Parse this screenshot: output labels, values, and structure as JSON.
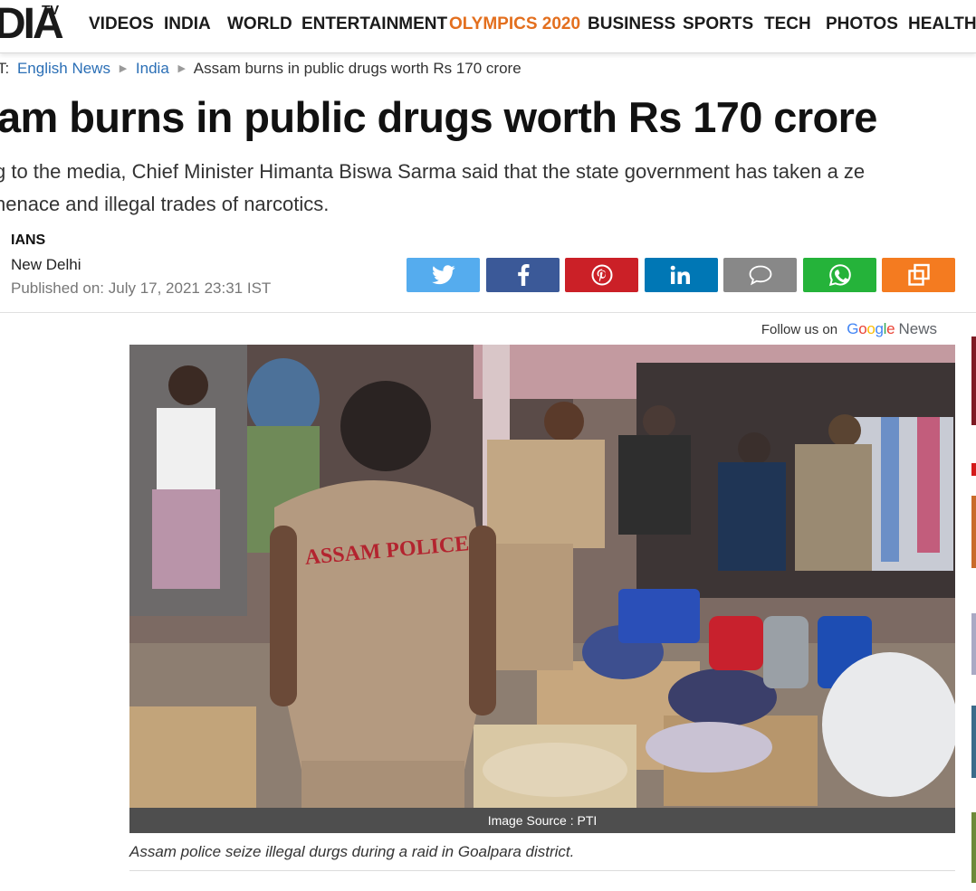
{
  "site": {
    "logo_text": "DIA",
    "logo_sup": "TV"
  },
  "nav": [
    {
      "label": "VIDEOS"
    },
    {
      "label": "INDIA"
    },
    {
      "label": "WORLD"
    },
    {
      "label": "ENTERTAINMENT"
    },
    {
      "label": "OLYMPICS 2020"
    },
    {
      "label": "BUSINESS"
    },
    {
      "label": "SPORTS"
    },
    {
      "label": "TECH"
    },
    {
      "label": "PHOTOS"
    },
    {
      "label": "HEALTH"
    }
  ],
  "colors": {
    "nav_highlight": "#e36f1e",
    "link_blue": "#2b6fb6",
    "twitter": "#55acee",
    "facebook": "#3b5998",
    "pinterest": "#cb2027",
    "linkedin": "#0077b5",
    "comment": "#888888",
    "whatsapp": "#25b33a",
    "copy": "#f47b20"
  },
  "breadcrumb": {
    "prefix": "T:",
    "items": [
      "English News",
      "India"
    ],
    "current": "Assam burns in public drugs worth Rs 170 crore"
  },
  "article": {
    "headline": "am burns in public drugs worth Rs 170 crore",
    "summary": "g to the media, Chief Minister Himanta Biswa Sarma said that the state government has taken a ze nenace and illegal trades of narcotics.",
    "summary_line1": "g to the media, Chief Minister Himanta Biswa Sarma said that the state government has taken a ze",
    "summary_line2": "nenace and illegal trades of narcotics.",
    "author": "IANS",
    "location": "New Delhi",
    "published": "Published on: July 17, 2021 23:31 IST"
  },
  "share_buttons": [
    {
      "name": "twitter",
      "icon": "twitter-icon"
    },
    {
      "name": "facebook",
      "icon": "facebook-icon"
    },
    {
      "name": "pinterest",
      "icon": "pinterest-icon"
    },
    {
      "name": "linkedin",
      "icon": "linkedin-icon"
    },
    {
      "name": "comment",
      "icon": "comment-icon"
    },
    {
      "name": "whatsapp",
      "icon": "whatsapp-icon"
    },
    {
      "name": "copy",
      "icon": "copy-icon"
    }
  ],
  "follow": {
    "prefix": "Follow us on",
    "google": "Google",
    "news": "News"
  },
  "image": {
    "source": "Image Source : PTI",
    "caption": "Assam police seize illegal durgs during a raid in Goalpara district.",
    "shirt_text": "ASSAM POLICE"
  }
}
